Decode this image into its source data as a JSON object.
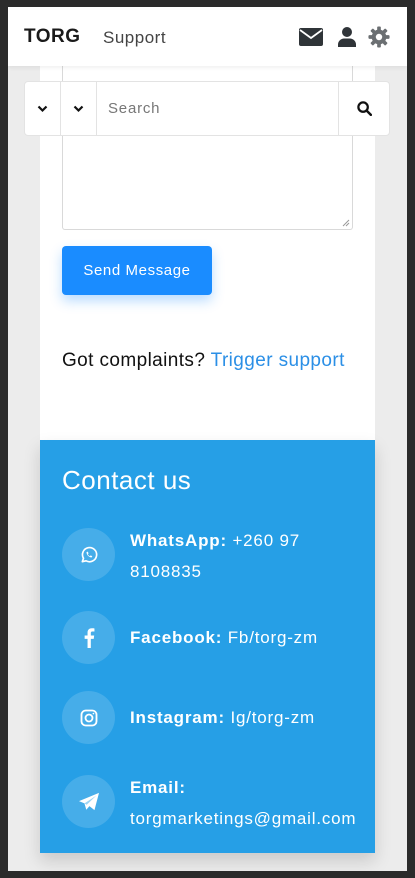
{
  "navbar": {
    "brand": "TORG",
    "support_link": "Support",
    "icons": [
      "envelope-icon",
      "user-icon",
      "gear-icon"
    ]
  },
  "search": {
    "placeholder": "Search",
    "value": ""
  },
  "form": {
    "send_label": "Send Message"
  },
  "complaints": {
    "text": "Got complaints?",
    "link": "Trigger support"
  },
  "contact": {
    "title": "Contact us",
    "items": [
      {
        "icon": "whatsapp-icon",
        "label": "WhatsApp:",
        "value": "+260 97 8108835"
      },
      {
        "icon": "facebook-icon",
        "label": "Facebook:",
        "value": "Fb/torg-zm"
      },
      {
        "icon": "instagram-icon",
        "label": "Instagram:",
        "value": "Ig/torg-zm"
      },
      {
        "icon": "telegram-icon",
        "label": "Email:",
        "value": "torgmarketings@gmail.com"
      }
    ]
  },
  "colors": {
    "primary_button": "#1a8cff",
    "contact_bg": "#269fe6",
    "link": "#2b8fe6"
  }
}
